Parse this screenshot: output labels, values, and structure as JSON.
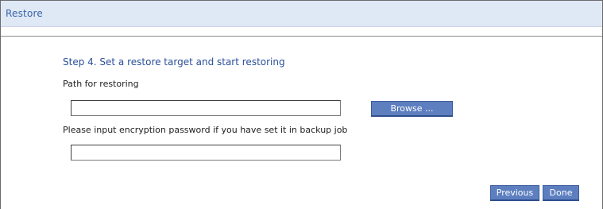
{
  "dialog": {
    "title": "Restore"
  },
  "step": {
    "heading": "Step 4. Set a restore target and start restoring",
    "path_label": "Path for restoring",
    "path_value": "",
    "browse_label": "Browse ...",
    "password_label": "Please input encryption password if you have set it in backup job",
    "password_value": ""
  },
  "footer": {
    "previous_label": "Previous",
    "done_label": "Done"
  }
}
